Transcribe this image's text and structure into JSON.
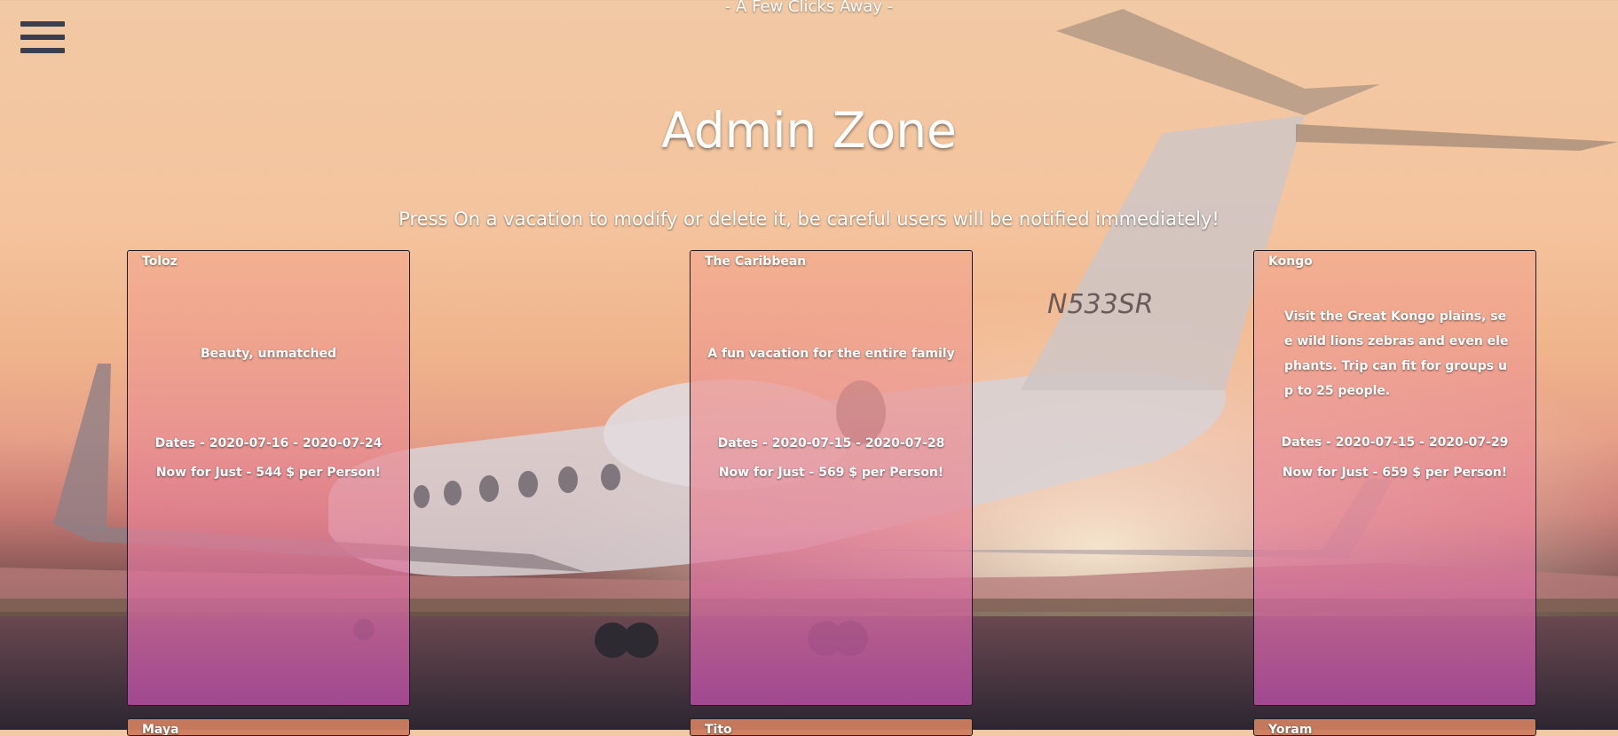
{
  "header": {
    "tagline": "- A Few Clicks Away -",
    "title": "Admin Zone",
    "subtitle": "Press On a vacation to modify or delete it, be careful users will be notified immediately!",
    "menu_icon": "hamburger-menu-icon"
  },
  "background": {
    "tail_registration": "N533SR"
  },
  "vacations": [
    {
      "name": "Toloz",
      "description": "Beauty, unmatched",
      "dates": "Dates - 2020-07-16 - 2020-07-24",
      "price": "Now for Just - 544 $ per Person!"
    },
    {
      "name": "The Caribbean",
      "description": "A fun vacation for the entire family",
      "dates": "Dates - 2020-07-15 - 2020-07-28",
      "price": "Now for Just - 569 $ per Person!"
    },
    {
      "name": "Kongo",
      "description": "Visit the Great Kongo plains, see wild lions zebras and even elephants. Trip can fit for groups up to 25 people.",
      "dates": "Dates - 2020-07-15 - 2020-07-29",
      "price": "Now for Just - 659 $ per Person!"
    },
    {
      "name": "Maya"
    },
    {
      "name": "Tito"
    },
    {
      "name": "Yoram"
    }
  ]
}
